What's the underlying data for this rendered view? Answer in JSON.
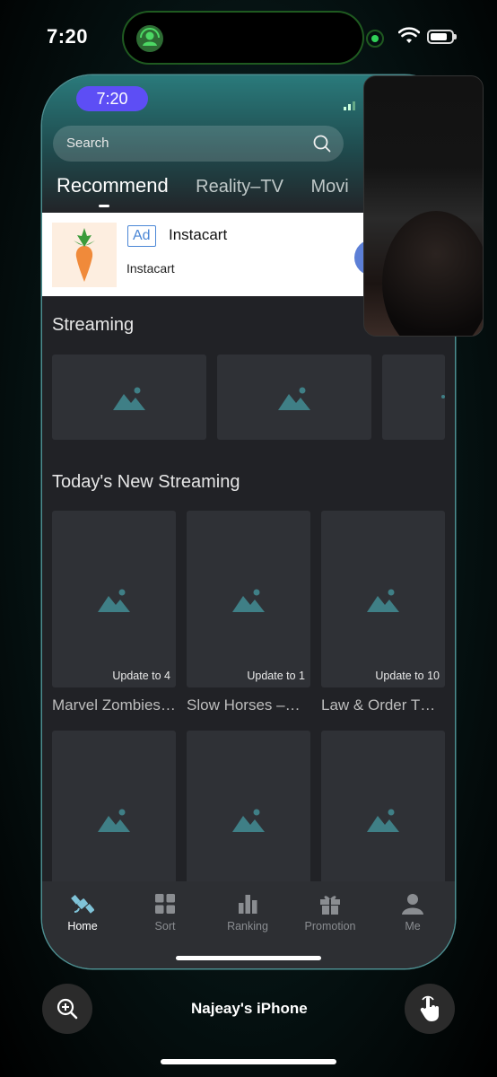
{
  "outer_status": {
    "time": "7:20"
  },
  "app": {
    "status_time": "7:20",
    "search": {
      "placeholder": "Search"
    },
    "tabs": [
      {
        "label": "Recommend",
        "active": true
      },
      {
        "label": "Reality–TV",
        "active": false
      },
      {
        "label": "Movi",
        "active": false
      }
    ],
    "ad": {
      "badge": "Ad",
      "title": "Instacart",
      "subtitle": "Instacart"
    },
    "sections": {
      "streaming": {
        "title": "Streaming"
      },
      "new_streaming": {
        "title": "Today's New Streaming",
        "items": [
          {
            "update": "Update to 4",
            "caption": "Marvel Zombies…"
          },
          {
            "update": "Update to 1",
            "caption": "Slow Horses –…"
          },
          {
            "update": "Update to 10",
            "caption": "Law & Order T…"
          }
        ]
      }
    },
    "tabbar": [
      {
        "label": "Home",
        "icon": "home-satellite-icon",
        "active": true
      },
      {
        "label": "Sort",
        "icon": "grid-icon",
        "active": false
      },
      {
        "label": "Ranking",
        "icon": "bar-chart-icon",
        "active": false
      },
      {
        "label": "Promotion",
        "icon": "gift-icon",
        "active": false
      },
      {
        "label": "Me",
        "icon": "person-icon",
        "active": false
      }
    ]
  },
  "mirroring": {
    "device_name": "Najeay's iPhone"
  },
  "colors": {
    "accent_teal": "#2a7a7b",
    "time_pill": "#5d4ef5",
    "ad_badge": "#4b87d6"
  }
}
